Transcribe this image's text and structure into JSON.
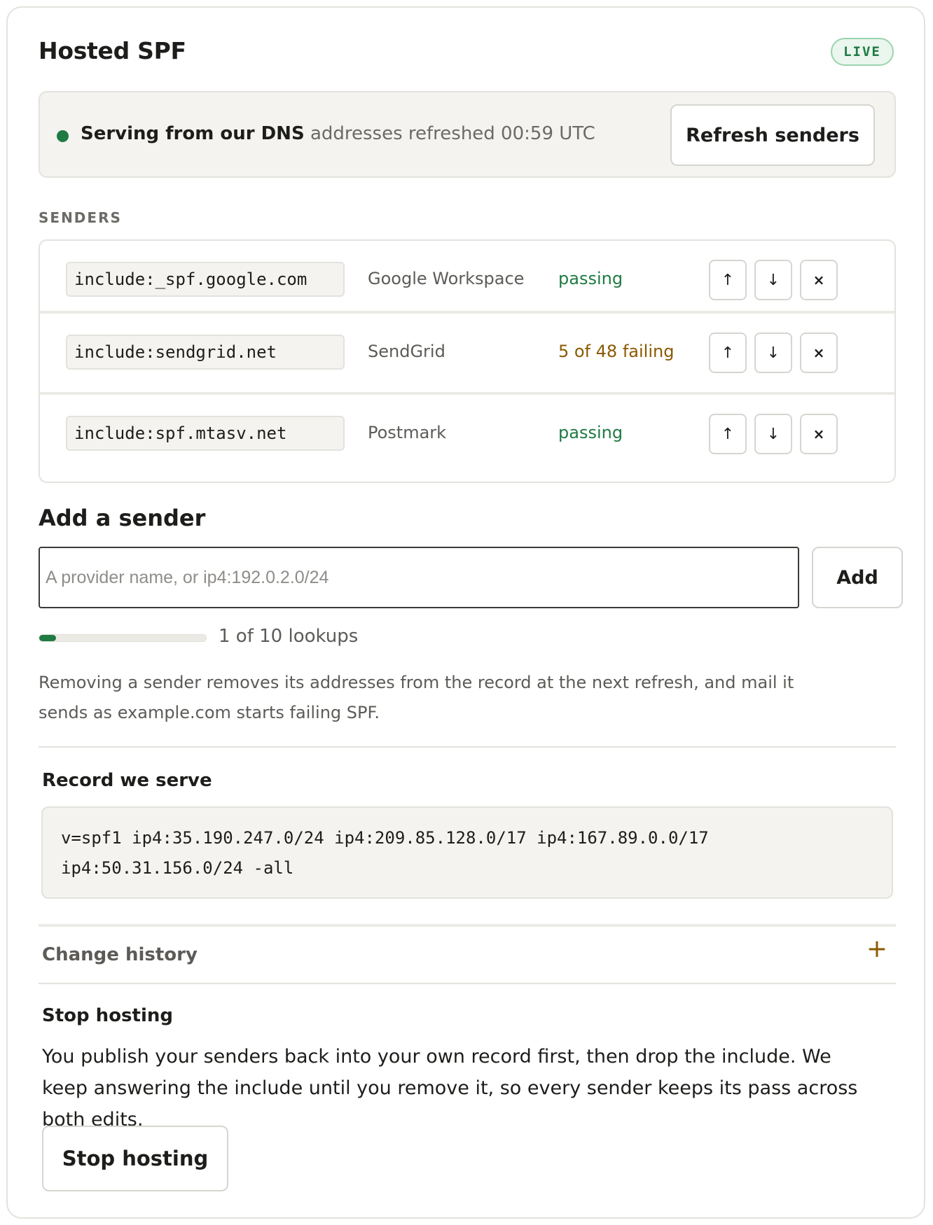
{
  "header": {
    "title": "Hosted SPF",
    "badge": "LIVE"
  },
  "status": {
    "headline": "Serving from our DNS",
    "detail": "addresses refreshed 00:59 UTC",
    "refresh_label": "Refresh senders",
    "dot_color": "#1f7a44"
  },
  "senders": {
    "label": "SENDERS",
    "rows": [
      {
        "mechanism": "include:_spf.google.com",
        "provider": "Google Workspace",
        "state": "passing",
        "state_kind": "pass"
      },
      {
        "mechanism": "include:sendgrid.net",
        "provider": "SendGrid",
        "state": "5 of 48 failing",
        "state_kind": "fail"
      },
      {
        "mechanism": "include:spf.mtasv.net",
        "provider": "Postmark",
        "state": "passing",
        "state_kind": "pass"
      }
    ],
    "controls": {
      "up": "↑",
      "down": "↓",
      "remove": "×"
    }
  },
  "add": {
    "heading": "Add a sender",
    "placeholder": "A provider name, or ip4:192.0.2.0/24",
    "button": "Add",
    "lookups_text": "1 of 10 lookups",
    "lookups_used": 1,
    "lookups_max": 10,
    "note": "Removing a sender removes its addresses from the record at the next refresh, and mail it sends as example.com starts failing SPF."
  },
  "record": {
    "heading": "Record we serve",
    "value": "v=spf1 ip4:35.190.247.0/24 ip4:209.85.128.0/17 ip4:167.89.0.0/17 ip4:50.31.156.0/24 -all"
  },
  "history": {
    "label": "Change history",
    "icon": "plus-icon"
  },
  "stop": {
    "heading": "Stop hosting",
    "text": "You publish your senders back into your own record first, then drop the include. We keep answering the include until you remove it, so every sender keeps its pass across both edits.",
    "button": "Stop hosting"
  },
  "colors": {
    "accent_green": "#1f7a44",
    "warning_amber": "#8a5a00",
    "panel_bg": "#f4f3ef"
  }
}
